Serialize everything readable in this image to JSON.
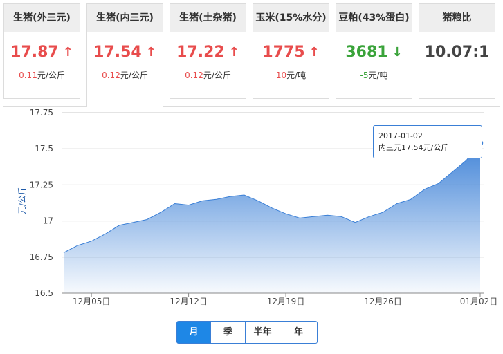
{
  "cards": [
    {
      "title": "生猪(外三元)",
      "price": "17.87",
      "trend": "up",
      "arrow": "↑",
      "change_value": "0.11",
      "change_unit": "元/公斤"
    },
    {
      "title": "生猪(内三元)",
      "price": "17.54",
      "trend": "up",
      "arrow": "↑",
      "change_value": "0.12",
      "change_unit": "元/公斤"
    },
    {
      "title": "生猪(土杂猪)",
      "price": "17.22",
      "trend": "up",
      "arrow": "↑",
      "change_value": "0.12",
      "change_unit": "元/公斤"
    },
    {
      "title": "玉米(15%水分)",
      "price": "1775",
      "trend": "up",
      "arrow": "↑",
      "change_value": "10",
      "change_unit": "元/吨"
    },
    {
      "title": "豆粕(43%蛋白)",
      "price": "3681",
      "trend": "down",
      "arrow": "↓",
      "change_value": "-5",
      "change_unit": "元/吨"
    },
    {
      "title": "猪粮比",
      "price": "10.07:1",
      "trend": "neutral",
      "arrow": "",
      "change_value": "",
      "change_unit": ""
    }
  ],
  "active_card_index": 1,
  "tooltip": {
    "date": "2017-01-02",
    "text": "内三元17.54元/公斤"
  },
  "period_buttons": [
    "月",
    "季",
    "半年",
    "年"
  ],
  "selected_period": "月",
  "colors": {
    "up": "#e84c4c",
    "down": "#3aa33a",
    "line": "#3a7fd6",
    "accent": "#1e87e6"
  },
  "chart_data": {
    "type": "area",
    "ylabel": "元/公斤",
    "xlabel": "",
    "ylim": [
      16.5,
      17.75
    ],
    "yticks": [
      "17.75",
      "17.5",
      "17.25",
      "17",
      "16.75",
      "16.5"
    ],
    "xtick_labels": [
      "12月05日",
      "12月12日",
      "12月19日",
      "12月26日",
      "01月02日"
    ],
    "grid": true,
    "x": [
      "2016-12-03",
      "2016-12-04",
      "2016-12-05",
      "2016-12-06",
      "2016-12-07",
      "2016-12-08",
      "2016-12-09",
      "2016-12-10",
      "2016-12-11",
      "2016-12-12",
      "2016-12-13",
      "2016-12-14",
      "2016-12-15",
      "2016-12-16",
      "2016-12-17",
      "2016-12-18",
      "2016-12-19",
      "2016-12-20",
      "2016-12-21",
      "2016-12-22",
      "2016-12-23",
      "2016-12-24",
      "2016-12-25",
      "2016-12-26",
      "2016-12-27",
      "2016-12-28",
      "2016-12-29",
      "2016-12-30",
      "2016-12-31",
      "2017-01-01",
      "2017-01-02"
    ],
    "series": [
      {
        "values": [
          16.78,
          16.83,
          16.86,
          16.91,
          16.97,
          16.99,
          17.01,
          17.06,
          17.12,
          17.11,
          17.14,
          17.15,
          17.17,
          17.18,
          17.14,
          17.09,
          17.05,
          17.02,
          17.03,
          17.04,
          17.03,
          16.99,
          17.03,
          17.06,
          17.12,
          17.15,
          17.22,
          17.26,
          17.34,
          17.42,
          17.54
        ]
      }
    ]
  }
}
